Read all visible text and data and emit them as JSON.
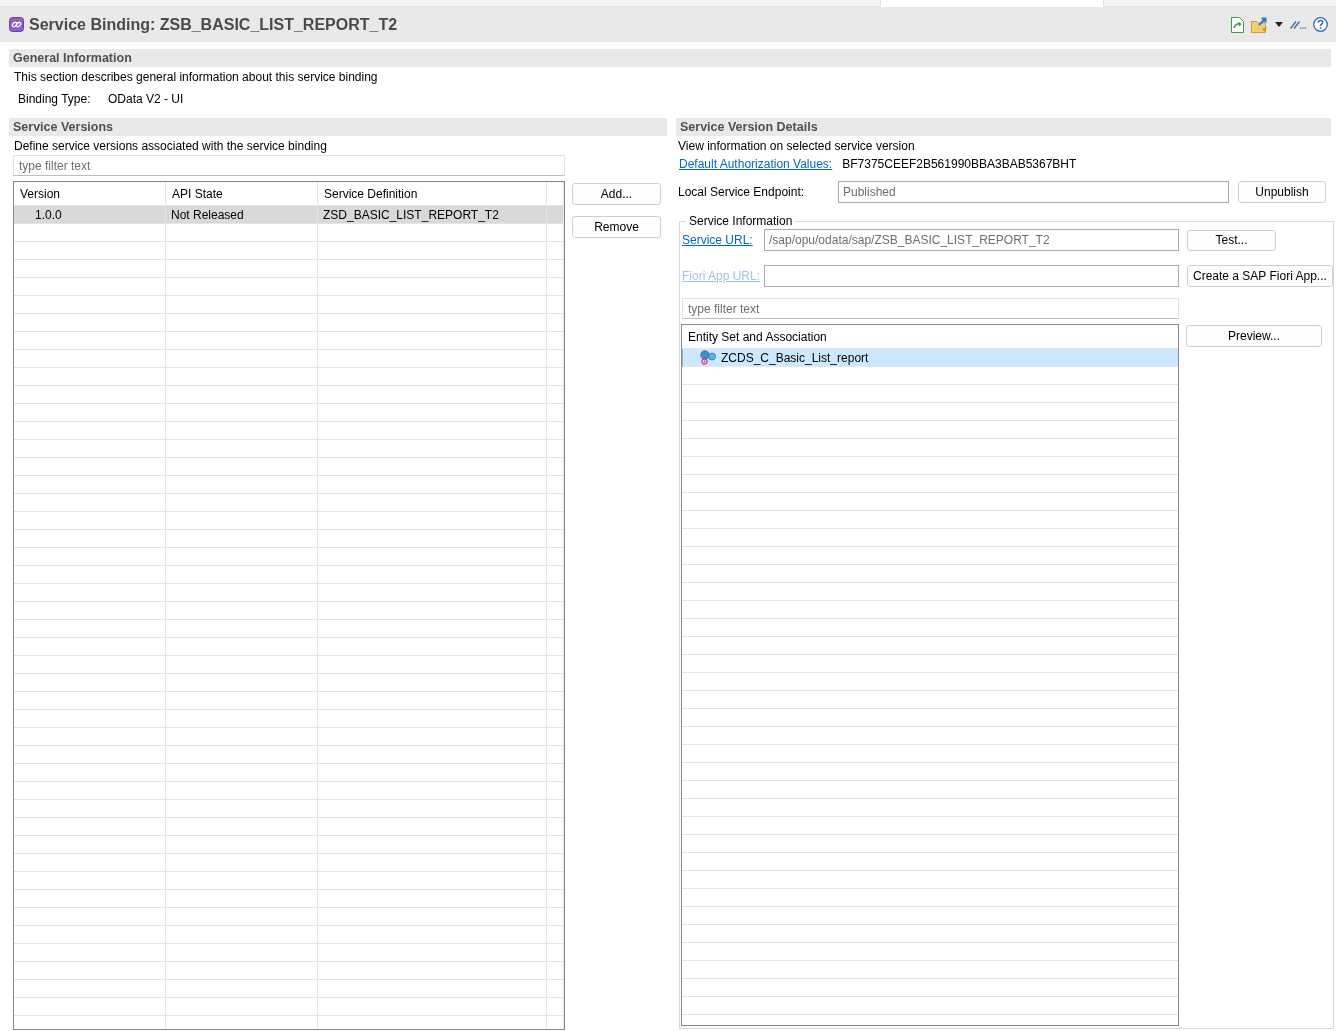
{
  "editor": {
    "title": "Service Binding: ZSB_BASIC_LIST_REPORT_T2"
  },
  "general_information": {
    "heading": "General Information",
    "description": "This section describes general information about this service binding",
    "binding_type": {
      "label": "Binding Type:",
      "value": "OData V2 - UI"
    }
  },
  "service_versions": {
    "heading": "Service Versions",
    "description": "Define service versions associated with the service binding",
    "filter": {
      "placeholder": "type filter text"
    },
    "table": {
      "columns": [
        "Version",
        "API State",
        "Service Definition"
      ],
      "rows": [
        {
          "cells": [
            "1.0.0",
            "Not Released",
            "ZSD_BASIC_LIST_REPORT_T2"
          ],
          "selected": true
        }
      ]
    },
    "buttons": [
      "Add...",
      "Remove"
    ]
  },
  "service_version_details": {
    "heading": "Service Version Details",
    "description": "View information on selected service version",
    "authorization": {
      "link": "Default Authorization Values:",
      "value": "BF7375CEEF2B561990BBA3BAB5367BHT"
    },
    "endpoint": {
      "label": "Local Service Endpoint:",
      "value": "Published",
      "button": "Unpublish"
    },
    "service_information": {
      "legend": "Service Information",
      "urls": [
        {
          "link": "Service URL:",
          "value": "/sap/opu/odata/sap/ZSB_BASIC_LIST_REPORT_T2",
          "disabled": false,
          "button": "Test..."
        },
        {
          "link": "Fiori App URL:",
          "disabled": true,
          "button": "Create a SAP Fiori App..."
        }
      ],
      "filter": {
        "placeholder": "type filter text"
      },
      "tree": {
        "column": "Entity Set and Association",
        "items": [
          {
            "label": "ZCDS_C_Basic_List_report",
            "selected": true
          }
        ]
      },
      "buttons": [
        "Preview..."
      ]
    }
  }
}
